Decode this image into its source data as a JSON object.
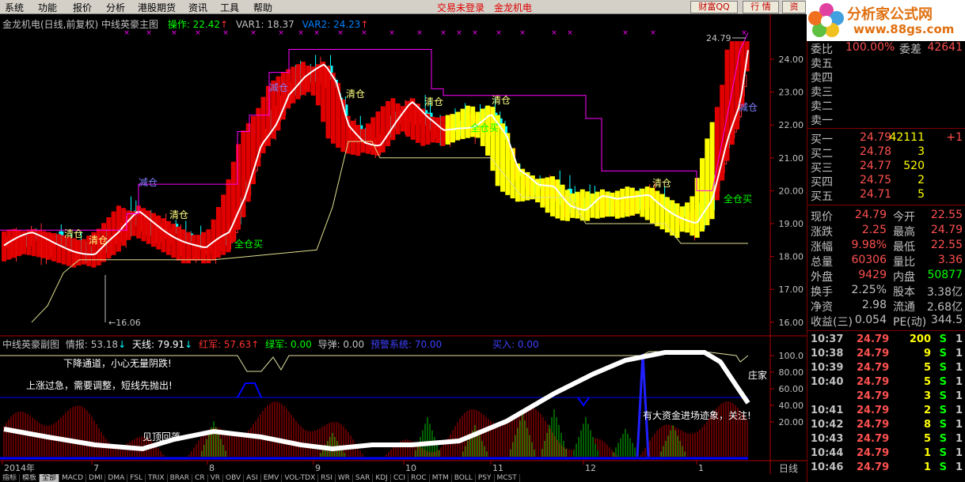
{
  "menu": {
    "items": [
      "系统",
      "功能",
      "报价",
      "分析",
      "港股期货",
      "资讯",
      "工具",
      "帮助"
    ],
    "status": [
      "交易未登录",
      "金龙机电"
    ],
    "buttons": [
      "财富QQ",
      "行 情",
      "资"
    ]
  },
  "logo": {
    "title": "分析家公式网",
    "url": "www.88gs.com"
  },
  "main_title": {
    "stock": "金龙机电(日线,前复权) 中线英豪主图",
    "op_label": "操作: 22.42",
    "var1": "VAR1: 18.37",
    "var2": "VAR2: 24.23"
  },
  "sub_title": {
    "name": "中线英豪副图",
    "qingbao": "情报: 53.18",
    "tianxian": "天线: 79.91",
    "hongjun": "红军: 57.63",
    "lvjun": "绿军: 0.00",
    "daotan": "导弹: 0.00",
    "yujing": "预警系统: 70.00",
    "mairu": "买入: 0.00"
  },
  "price_axis": [
    "24.00",
    "23.00",
    "22.00",
    "21.00",
    "20.00",
    "19.00",
    "18.00",
    "17.00",
    "16.00"
  ],
  "sub_axis": [
    "100.0",
    "80.00",
    "60.00",
    "40.00",
    "20.00"
  ],
  "annotations": {
    "high": "24.79",
    "low": "16.06",
    "labels": [
      {
        "t": "清仓"
      },
      {
        "t": "清仓"
      },
      {
        "t": "减仓"
      },
      {
        "t": "清仓"
      },
      {
        "t": "全仓买"
      },
      {
        "t": "减仓"
      },
      {
        "t": "清仓"
      },
      {
        "t": "清仓"
      },
      {
        "t": "清仓"
      },
      {
        "t": "全仓买"
      },
      {
        "t": "清仓"
      },
      {
        "t": "减仓"
      },
      {
        "t": "全仓买"
      }
    ],
    "sub": [
      "下降通道，小心无量阴跌!",
      "上涨过急，需要调整，短线先抛出!",
      "见顶回落",
      "有大资金进场迹象，关注!",
      "庄家"
    ]
  },
  "date_axis": [
    "2014年",
    "7",
    "8",
    "9",
    "10",
    "11",
    "12",
    "1"
  ],
  "daxian": "日线",
  "order_book": {
    "header": {
      "label": "委比",
      "value": "100.00%",
      "label2": "委差",
      "value2": "42641"
    },
    "sell": [
      {
        "label": "卖五"
      },
      {
        "label": "卖四"
      },
      {
        "label": "卖三"
      },
      {
        "label": "卖二"
      },
      {
        "label": "卖一"
      }
    ],
    "buy": [
      {
        "label": "买一",
        "price": "24.79",
        "vol": "42111",
        "chg": "+1"
      },
      {
        "label": "买二",
        "price": "24.78",
        "vol": "3",
        "chg": ""
      },
      {
        "label": "买三",
        "price": "24.77",
        "vol": "520",
        "chg": ""
      },
      {
        "label": "买四",
        "price": "24.75",
        "vol": "2",
        "chg": ""
      },
      {
        "label": "买五",
        "price": "24.71",
        "vol": "5",
        "chg": ""
      }
    ]
  },
  "quote": [
    {
      "l1": "现价",
      "v1": "24.79",
      "l2": "今开",
      "v2": "22.55"
    },
    {
      "l1": "涨跌",
      "v1": "2.25",
      "l2": "最高",
      "v2": "24.79"
    },
    {
      "l1": "涨幅",
      "v1": "9.98%",
      "l2": "最低",
      "v2": "22.55"
    },
    {
      "l1": "总量",
      "v1": "60306",
      "l2": "量比",
      "v2": "3.36"
    },
    {
      "l1": "外盘",
      "v1": "9429",
      "l2": "内盘",
      "v2": "50877"
    },
    {
      "l1": "换手",
      "v1": "2.25%",
      "l2": "股本",
      "v2": "3.38亿"
    },
    {
      "l1": "净资",
      "v1": "2.98",
      "l2": "流通",
      "v2": "2.68亿"
    },
    {
      "l1": "收益(三)",
      "v1": "0.054",
      "l2": "PE(动)",
      "v2": "344.5"
    }
  ],
  "ticks": [
    {
      "time": "10:37",
      "price": "24.79",
      "vol": "200",
      "side": "S",
      "n": "1"
    },
    {
      "time": "10:38",
      "price": "24.79",
      "vol": "9",
      "side": "S",
      "n": "1"
    },
    {
      "time": "10:39",
      "price": "24.79",
      "vol": "5",
      "side": "S",
      "n": "1"
    },
    {
      "time": "10:40",
      "price": "24.79",
      "vol": "5",
      "side": "S",
      "n": "1"
    },
    {
      "time": "",
      "price": "24.79",
      "vol": "3",
      "side": "S",
      "n": "1"
    },
    {
      "time": "10:41",
      "price": "24.79",
      "vol": "2",
      "side": "S",
      "n": "1"
    },
    {
      "time": "10:42",
      "price": "24.79",
      "vol": "8",
      "side": "S",
      "n": "1"
    },
    {
      "time": "10:43",
      "price": "24.79",
      "vol": "5",
      "side": "S",
      "n": "1"
    },
    {
      "time": "10:44",
      "price": "24.79",
      "vol": "1",
      "side": "S",
      "n": "1"
    },
    {
      "time": "10:46",
      "price": "24.79",
      "vol": "1",
      "side": "S",
      "n": "1"
    }
  ],
  "tabs": [
    "指标",
    "模板",
    "全部",
    "MACD",
    "DMI",
    "DMA",
    "FSL",
    "TRIX",
    "BRAR",
    "CR",
    "VR",
    "OBV",
    "ASI",
    "EMV",
    "VOL-TDX",
    "RSI",
    "WR",
    "SAR",
    "KDJ",
    "CCI",
    "ROC",
    "MTM",
    "BOLL",
    "PSY",
    "MCST"
  ],
  "colors": {
    "up": "#ff3030",
    "down": "#00ffff",
    "yellow": "#ffff00",
    "magenta": "#ff00ff",
    "white": "#ffffff",
    "blue": "#0000ff",
    "green": "#00ff00"
  }
}
